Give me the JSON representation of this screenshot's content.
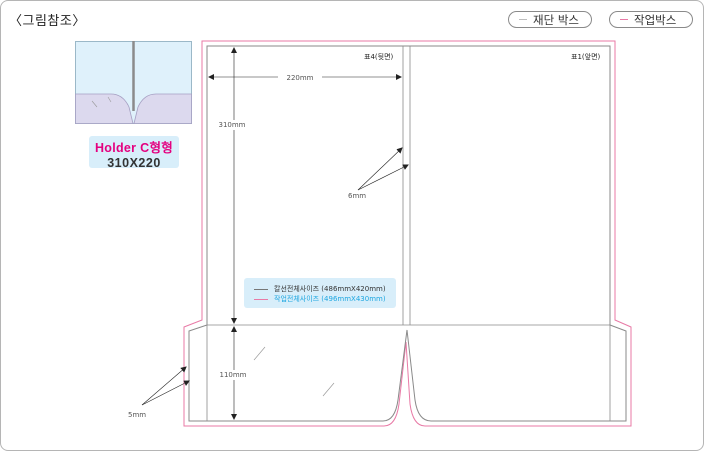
{
  "reference_title": "〈그림참조〉",
  "legend": {
    "cut_label": "재단 박스",
    "work_label": "작업박스",
    "cut_color": "#bdbdbd",
    "work_color": "#e87aa6"
  },
  "thumbnail": {
    "name": "Holder C형형",
    "size": "310X220"
  },
  "dimensions": {
    "width": "220mm",
    "height": "310mm",
    "spine": "6mm",
    "pocket": "110mm",
    "margin": "5mm"
  },
  "faces": {
    "back": "표4(뒷면)",
    "front": "표1(앞면)"
  },
  "info": {
    "cut_size": "칼선전체사이즈 (486mmX420mm)",
    "work_size": "작업전체사이즈 (496mmX430mm)"
  },
  "colors": {
    "caption_pink": "#e4007f",
    "info_cyan": "#1fa7e0",
    "label_bg": "#d8eefa"
  }
}
